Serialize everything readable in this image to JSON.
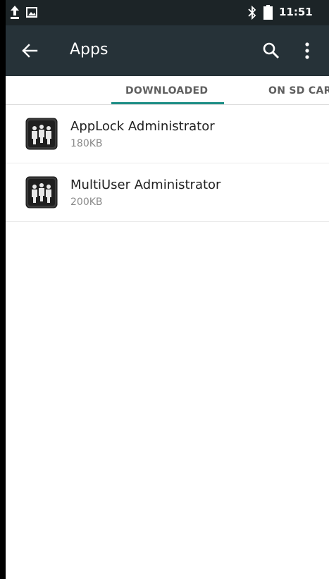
{
  "status_bar": {
    "time": "11:51",
    "icons": [
      "upload-icon",
      "image-icon",
      "bluetooth-icon",
      "battery-icon"
    ]
  },
  "app_bar": {
    "title": "Apps",
    "icons": [
      "back-arrow-icon",
      "search-icon",
      "more-vert-icon"
    ]
  },
  "tabs": [
    {
      "label": "DOWNLOADED",
      "selected": true
    },
    {
      "label": "ON SD CARD",
      "selected": false
    }
  ],
  "apps": [
    {
      "name": "AppLock Administrator",
      "size": "180KB",
      "icon": "multi-user-admin-icon"
    },
    {
      "name": "MultiUser Administrator",
      "size": "200KB",
      "icon": "multi-user-admin-icon"
    }
  ],
  "colors": {
    "status_bar": "#1c2427",
    "app_bar": "#263238",
    "tab_indicator": "#1d8e86",
    "background": "#ffffff"
  }
}
